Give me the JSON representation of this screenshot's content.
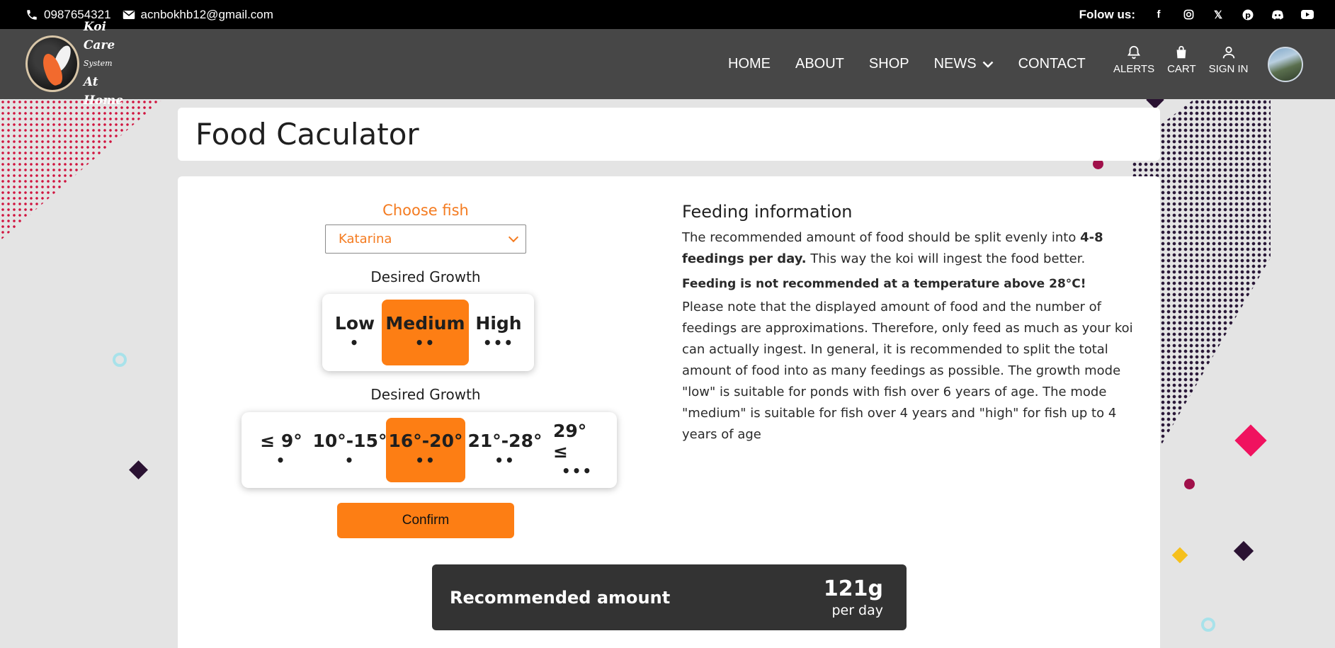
{
  "topbar": {
    "phone": "0987654321",
    "email": "acnbokhb12@gmail.com",
    "follow_label": "Folow us:",
    "socials": [
      "facebook-icon",
      "instagram-icon",
      "x-icon",
      "pinterest-icon",
      "discord-icon",
      "youtube-icon"
    ]
  },
  "logo": {
    "line1": "Koi Care",
    "line2": "System",
    "line3": "At Home"
  },
  "nav": {
    "home": "HOME",
    "about": "ABOUT",
    "shop": "SHOP",
    "news": "NEWS",
    "contact": "CONTACT",
    "alerts": "ALERTS",
    "cart": "CART",
    "sign_in": "SIGN IN"
  },
  "page": {
    "title": "Food Caculator"
  },
  "calculator": {
    "choose_fish_label": "Choose fish",
    "fish_selected": "Katarina",
    "growth_label": "Desired Growth",
    "growth_options": [
      {
        "label": "Low",
        "dots": "•"
      },
      {
        "label": "Medium",
        "dots": "••"
      },
      {
        "label": "High",
        "dots": "•••"
      }
    ],
    "growth_selected": "Medium",
    "temp_label": "Desired Growth",
    "temp_options": [
      {
        "label": "≤ 9°",
        "dots": "•"
      },
      {
        "label": "10°-15°",
        "dots": "•"
      },
      {
        "label": "16°-20°",
        "dots": "••"
      },
      {
        "label": "21°-28°",
        "dots": "••"
      },
      {
        "label": "29° ≤",
        "dots": "•••"
      }
    ],
    "temp_selected": "16°-20°",
    "confirm_label": "Confirm"
  },
  "info": {
    "heading": "Feeding information",
    "p1_start": "The recommended amount of food should be split evenly into ",
    "p1_bold": "4-8 feedings per day.",
    "p1_end": " This way the koi will ingest the food better.",
    "warning": "Feeding is not recommended at a temperature above 28°C!",
    "p2": "Please note that the displayed amount of food and the number of feedings are approximations. Therefore, only feed as much as your koi can actually ingest. In general, it is recommended to split the total amount of food into as many feedings as possible. The growth mode \"low\" is suitable for ponds with fish over 6 years of age. The mode \"medium\" is suitable for fish over 4 years and \"high\" for fish up to 4 years of age"
  },
  "result": {
    "label": "Recommended amount",
    "value": "121g",
    "unit": "per day"
  },
  "colors": {
    "accent": "#fd7e14",
    "topbar": "#000000",
    "navbar": "#474747",
    "result_bg": "#333333"
  }
}
